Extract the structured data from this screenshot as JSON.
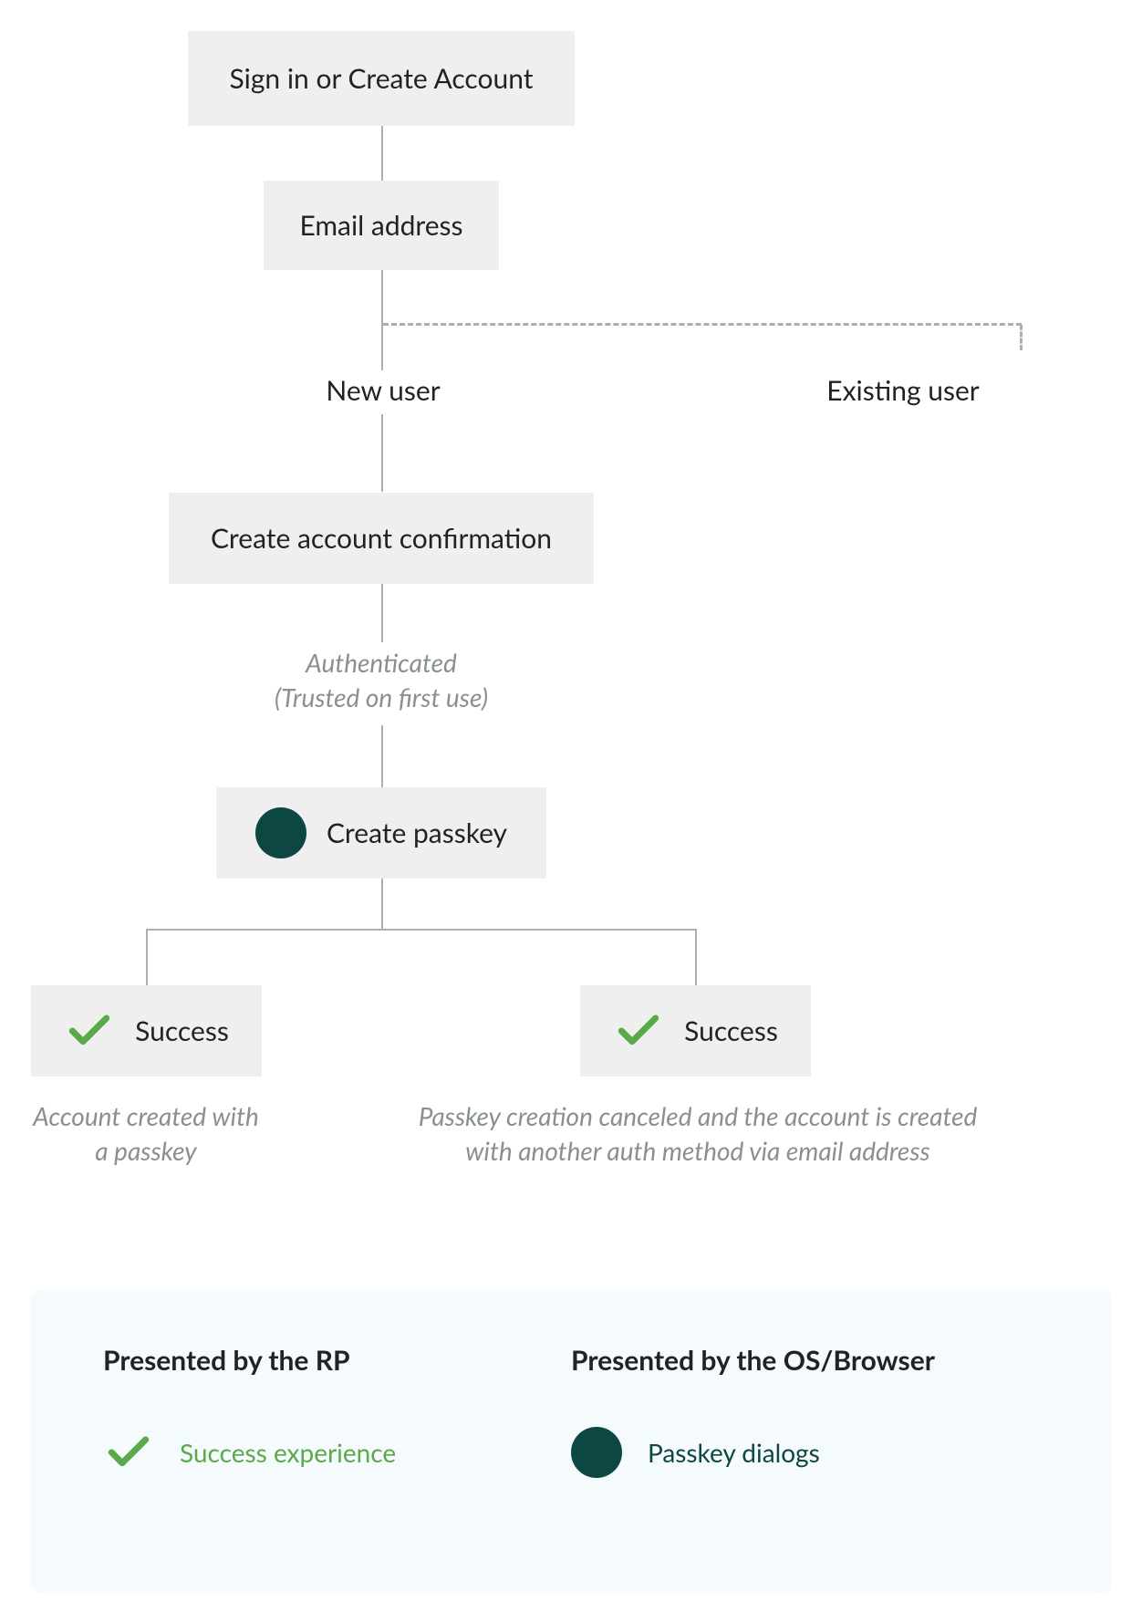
{
  "nodes": {
    "start": "Sign in or Create Account",
    "email": "Email address",
    "create_confirm": "Create account confirmation",
    "create_passkey": "Create passkey",
    "success_left": "Success",
    "success_right": "Success"
  },
  "labels": {
    "new_user": "New user",
    "existing_user": "Existing user"
  },
  "captions": {
    "authenticated_l1": "Authenticated",
    "authenticated_l2": "(Trusted on first use)",
    "success_left_l1": "Account created with",
    "success_left_l2": "a passkey",
    "success_right_l1": "Passkey creation canceled and the account is created",
    "success_right_l2": "with another auth method via email address"
  },
  "legend": {
    "left_title": "Presented by the RP",
    "right_title": "Presented by the OS/Browser",
    "success_exp": "Success experience",
    "passkey_dialogs": "Passkey dialogs"
  },
  "colors": {
    "node_bg": "#efefef",
    "connector": "#a9afb2",
    "caption": "#8a8f92",
    "accent_green": "#5aaa4a",
    "accent_teal": "#0d4744",
    "legend_bg": "#f5fafc"
  }
}
